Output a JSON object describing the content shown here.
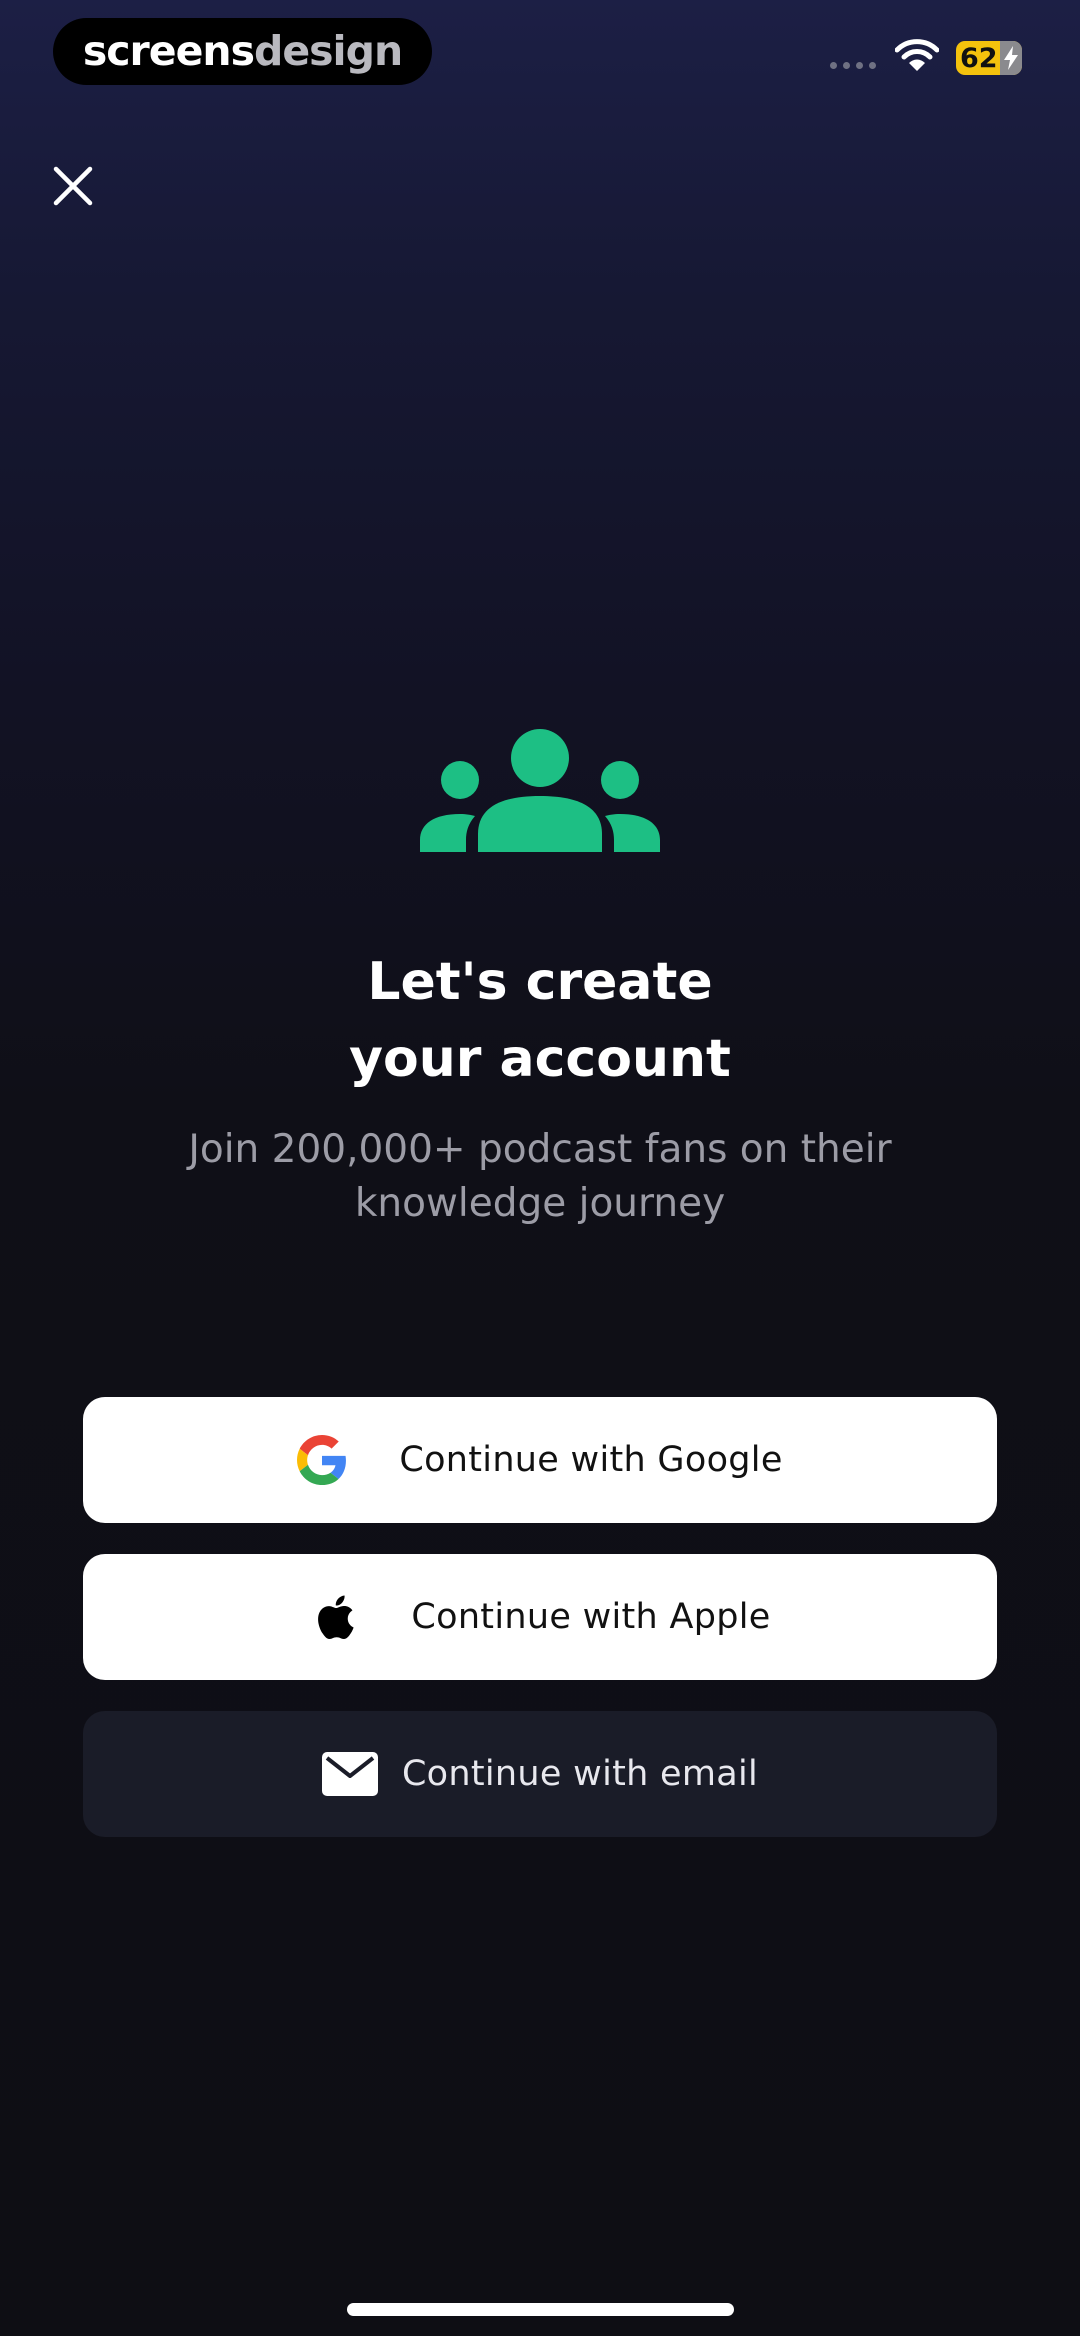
{
  "status_bar": {
    "brand_part1": "screens",
    "brand_part2": "design",
    "battery_level": "62"
  },
  "header": {
    "close_icon": "close-icon"
  },
  "hero": {
    "icon": "people-group-icon",
    "title_line1": "Let's create",
    "title_line2": "your account",
    "subtitle_line1": "Join 200,000+ podcast fans on their",
    "subtitle_line2": "knowledge journey"
  },
  "auth": {
    "google_label": "Continue with Google",
    "apple_label": "Continue with Apple",
    "email_label": "Continue with email"
  },
  "colors": {
    "accent": "#1dbf84",
    "background_top": "#1c1f45",
    "background_bottom": "#0e0e14",
    "button_light": "#ffffff",
    "button_dark": "#1a1c28",
    "subtitle": "#9c9ca6",
    "battery": "#f4c20d"
  }
}
